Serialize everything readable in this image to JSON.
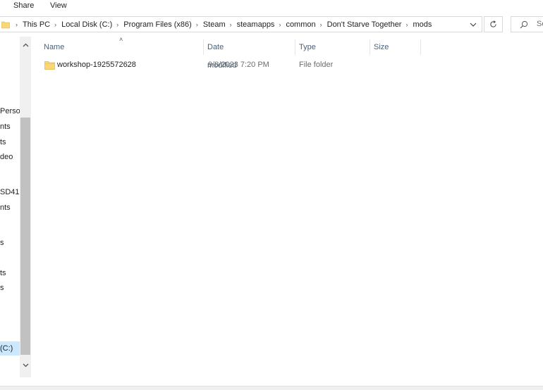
{
  "ribbon": {
    "tabs": [
      "Share",
      "View"
    ]
  },
  "address": {
    "crumbs": [
      "This PC",
      "Local Disk (C:)",
      "Program Files (x86)",
      "Steam",
      "steamapps",
      "common",
      "Don't Starve Together",
      "mods"
    ],
    "dropdown_icon": "chevron-down-icon"
  },
  "refresh_icon": "refresh-icon",
  "search": {
    "placeholder": "Se"
  },
  "nav": {
    "items": [
      "Persor",
      "nts",
      "ts",
      "deo",
      "SD41",
      "nts",
      "s",
      "ts",
      "s",
      "(C:)"
    ],
    "selected_index": 9
  },
  "columns": {
    "name": "Name",
    "date": "Date modified",
    "type": "Type",
    "size": "Size",
    "sort": "ascending"
  },
  "files": [
    {
      "name": "workshop-1925572628",
      "date": "9/8/2023 7:20 PM",
      "type": "File folder",
      "size": ""
    }
  ],
  "colors": {
    "folder": "#f8d775",
    "selection": "#cce8ff",
    "header_text": "#4c607a"
  }
}
